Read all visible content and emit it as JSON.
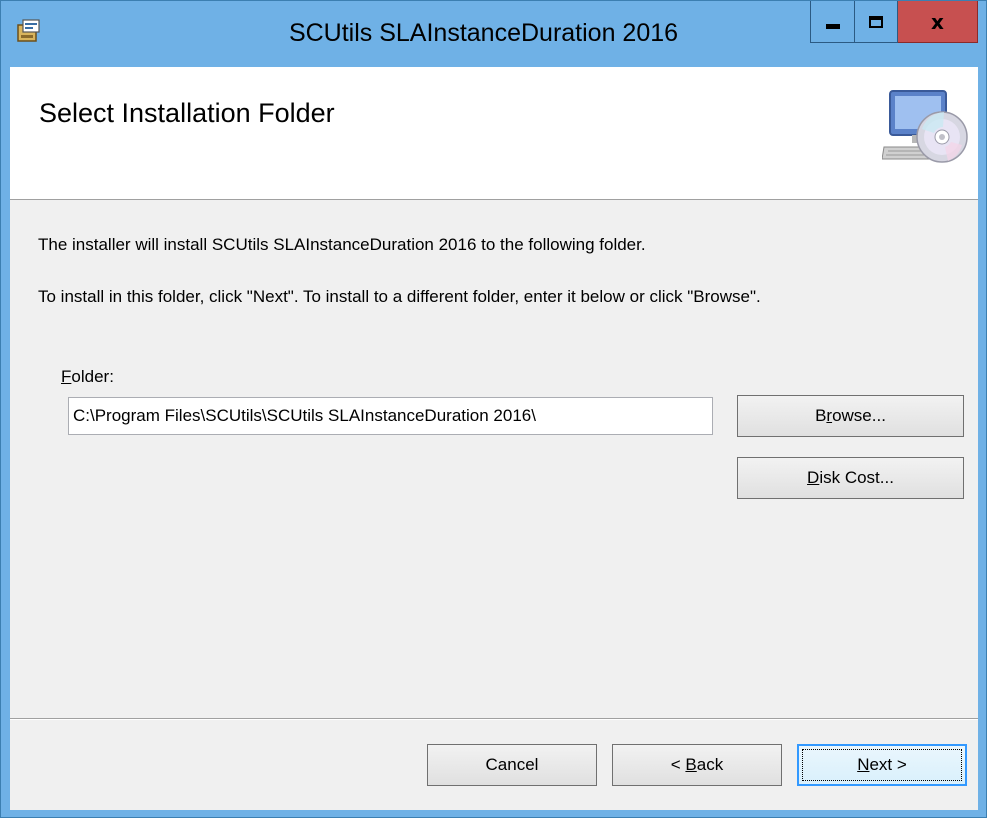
{
  "window": {
    "title": "SCUtils SLAInstanceDuration 2016",
    "icon": "installer-package-icon",
    "controls": {
      "minimize": "minimize-icon",
      "maximize": "maximize-icon",
      "close": "x"
    }
  },
  "banner": {
    "title": "Select Installation Folder",
    "icon": "computer-cd-icon"
  },
  "body": {
    "line1": "The installer will install SCUtils SLAInstanceDuration 2016 to the following folder.",
    "line2": "To install in this folder, click \"Next\". To install to a different folder, enter it below or click \"Browse\"."
  },
  "folder": {
    "label_accel": "F",
    "label_rest": "older:",
    "value": "C:\\Program Files\\SCUtils\\SCUtils SLAInstanceDuration 2016\\"
  },
  "buttons": {
    "browse_pre": "B",
    "browse_accel": "r",
    "browse_post": "owse...",
    "diskcost_accel": "D",
    "diskcost_post": "isk Cost...",
    "cancel": "Cancel",
    "back_pre": "< ",
    "back_accel": "B",
    "back_post": "ack",
    "next_accel": "N",
    "next_post": "ext >"
  },
  "colors": {
    "titlebar": "#6fb1e6",
    "close_button": "#c75050",
    "client_bg": "#f0f0f0",
    "banner_bg": "#ffffff",
    "default_button_border": "#3399ff"
  }
}
